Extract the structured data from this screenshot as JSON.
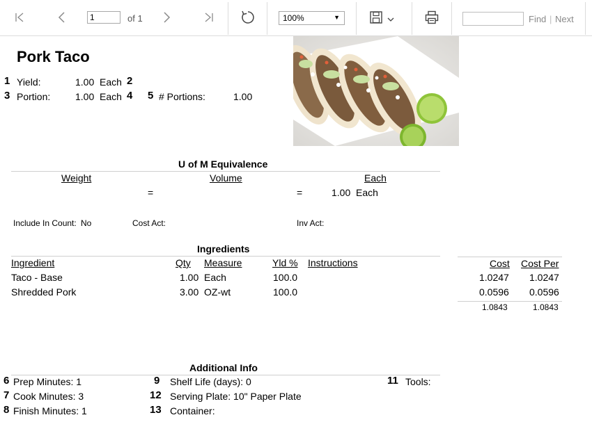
{
  "toolbar": {
    "page_value": "1",
    "page_of": "of 1",
    "zoom": "100%",
    "find_placeholder": "",
    "find_label": "Find",
    "find_separator": "|",
    "next_label": "Next"
  },
  "recipe": {
    "title": "Pork Taco",
    "yield_num": "1",
    "yield_label": "Yield:",
    "yield_value": "1.00",
    "yield_unit": "Each",
    "yield_num2": "2",
    "portion_num": "3",
    "portion_label": "Portion:",
    "portion_value": "1.00",
    "portion_unit": "Each",
    "portion_num2": "4",
    "portions_num": "5",
    "portions_label": "# Portions:",
    "portions_value": "1.00"
  },
  "uom": {
    "heading": "U of M Equivalence",
    "weight": "Weight",
    "volume": "Volume",
    "each": "Each",
    "eq1": "=",
    "eq2": "=",
    "each_value": "1.00",
    "each_unit": "Each"
  },
  "flags": {
    "include_label": "Include In Count:",
    "include_value": "No",
    "cost_act_label": "Cost Act:",
    "inv_act_label": "Inv Act:"
  },
  "ingredients": {
    "heading": "Ingredients",
    "col_ingredient": "Ingredient",
    "col_qty": "Qty",
    "col_measure": "Measure",
    "col_yld": "Yld %",
    "col_instructions": "Instructions",
    "col_cost": "Cost",
    "col_cost_per": "Cost Per",
    "rows": [
      {
        "name": "Taco - Base",
        "qty": "1.00",
        "measure": "Each",
        "yld": "100.0",
        "cost": "1.0247",
        "cost_per": "1.0247"
      },
      {
        "name": "Shredded Pork",
        "qty": "3.00",
        "measure": "OZ-wt",
        "yld": "100.0",
        "cost": "0.0596",
        "cost_per": "0.0596"
      }
    ],
    "total_cost": "1.0843",
    "total_cost_per": "1.0843"
  },
  "additional": {
    "heading": "Additional Info",
    "prep_num": "6",
    "prep": "Prep Minutes: 1",
    "cook_num": "7",
    "cook": "Cook Minutes: 3",
    "finish_num": "8",
    "finish": "Finish Minutes: 1",
    "shelf_num": "9",
    "shelf": "Shelf Life (days): 0",
    "plate_num": "12",
    "plate": "Serving Plate: 10\" Paper Plate",
    "container_num": "13",
    "container": "Container:",
    "tools_num": "11",
    "tools": "Tools:"
  }
}
